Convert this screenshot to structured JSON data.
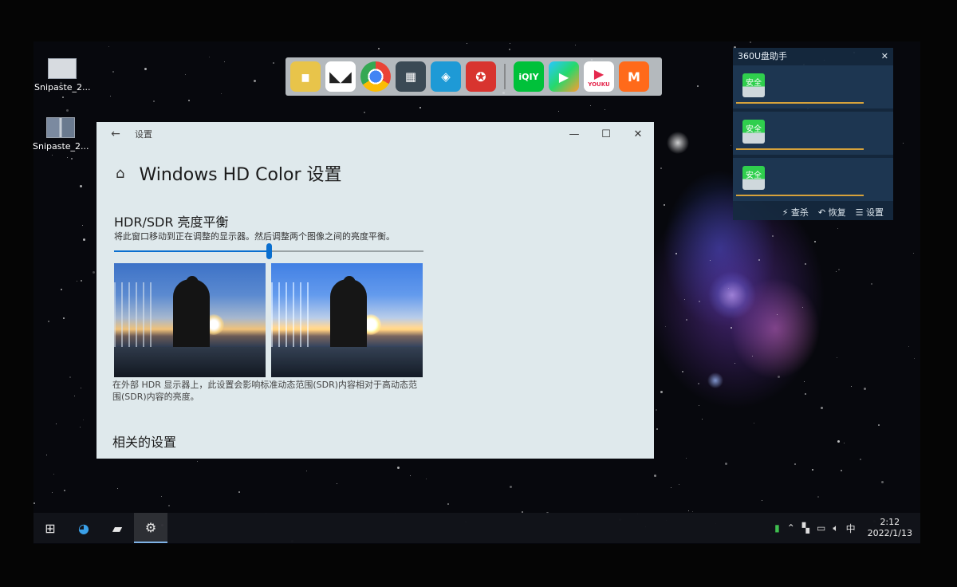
{
  "desktop": {
    "icons": [
      {
        "label": "Snipaste_2..."
      },
      {
        "label": "Snipaste_2..."
      }
    ]
  },
  "dock": {
    "apps": [
      "folder",
      "foxit",
      "chrome",
      "windows-tiles",
      "3d-builder",
      "media-player",
      "iqiyi",
      "tencent-video",
      "youku",
      "mango-tv"
    ],
    "iqiyi_text": "iQIY",
    "youku_text": "YOUKU",
    "mango_text": "M"
  },
  "settings_window": {
    "title_bar": "设置",
    "page_title": "Windows HD Color 设置",
    "section_title": "HDR/SDR 亮度平衡",
    "section_desc": "将此窗口移动到正在调整的显示器。然后调整两个图像之间的亮度平衡。",
    "slider_value": 0.5,
    "hdr_note": "在外部 HDR 显示器上，此设置会影响标准动态范围(SDR)内容相对于高动态范围(SDR)内容的亮度。",
    "related_title": "相关的设置",
    "minimize": "—",
    "maximize": "☐",
    "close": "✕",
    "back": "←",
    "home": "⌂"
  },
  "usb_panel": {
    "title": "360U盘助手",
    "close": "✕",
    "drives": [
      {
        "badge": "安全"
      },
      {
        "badge": "安全"
      },
      {
        "badge": "安全"
      }
    ],
    "actions": {
      "scan": "查杀",
      "restore": "恢复",
      "settings": "设置"
    }
  },
  "taskbar": {
    "clock_time": "2:12",
    "clock_date": "2022/1/13",
    "ime": "中"
  }
}
